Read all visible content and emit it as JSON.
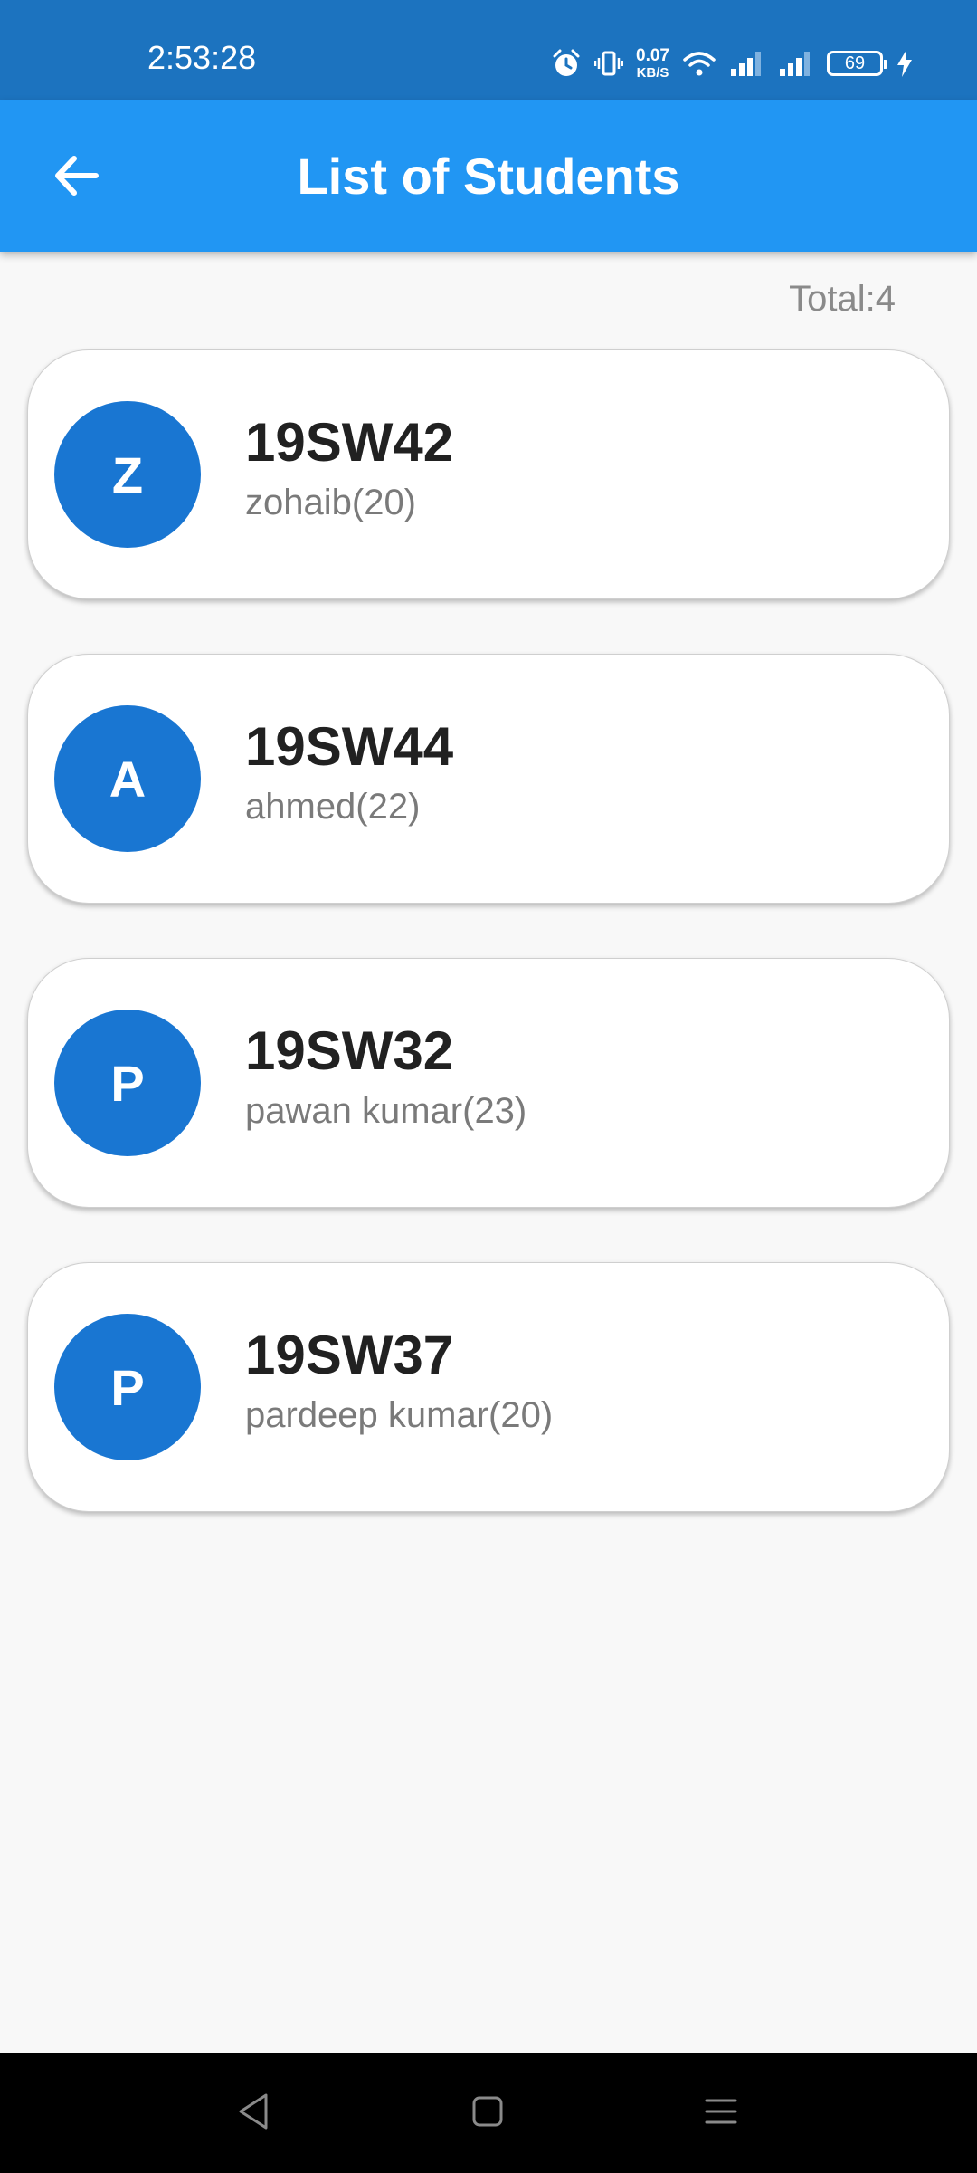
{
  "status_bar": {
    "time": "2:53:28",
    "net_speed": "0.07",
    "net_unit": "KB/S",
    "battery": "69"
  },
  "app_bar": {
    "title": "List of Students"
  },
  "summary": {
    "total_label": "Total:4"
  },
  "students": [
    {
      "initial": "Z",
      "roll": "19SW42",
      "name": "zohaib(20)"
    },
    {
      "initial": "A",
      "roll": "19SW44",
      "name": "ahmed(22)"
    },
    {
      "initial": "P",
      "roll": "19SW32",
      "name": "pawan kumar(23)"
    },
    {
      "initial": "P",
      "roll": "19SW37",
      "name": "pardeep kumar(20)"
    }
  ],
  "colors": {
    "status_bar": "#1c73bf",
    "app_bar": "#2196f3",
    "avatar": "#1976d2",
    "background": "#f8f8f8"
  },
  "icons": {
    "back": "arrow-left-icon",
    "alarm": "alarm-icon",
    "vibrate": "vibrate-icon",
    "wifi": "wifi-icon",
    "signal": "signal-icon",
    "charging": "charging-bolt-icon",
    "nav_back": "triangle-back-icon",
    "nav_home": "square-home-icon",
    "nav_menu": "menu-lines-icon"
  }
}
